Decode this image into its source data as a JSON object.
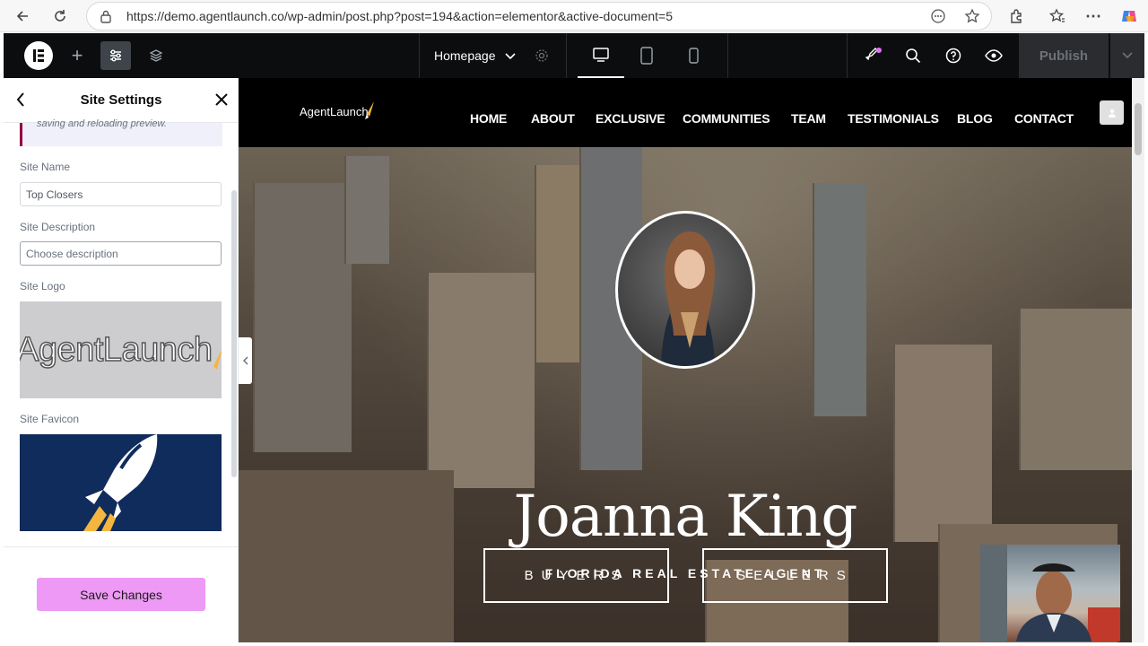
{
  "browser": {
    "url": "https://demo.agentlaunch.co/wp-admin/post.php?post=194&action=elementor&active-document=5"
  },
  "editor": {
    "page_selector": "Homepage",
    "publish_label": "Publish"
  },
  "panel": {
    "title": "Site Settings",
    "notice_text": "saving and reloading preview.",
    "site_name_label": "Site Name",
    "site_name_value": "Top Closers",
    "site_description_label": "Site Description",
    "site_description_placeholder": "Choose description",
    "site_logo_label": "Site Logo",
    "logo_text": "AgentLaunch",
    "site_favicon_label": "Site Favicon",
    "save_label": "Save Changes"
  },
  "site": {
    "logo_text": "AgentLaunch",
    "nav": [
      "HOME",
      "ABOUT",
      "EXCLUSIVE",
      "COMMUNITIES",
      "TEAM",
      "TESTIMONIALS",
      "BLOG",
      "CONTACT"
    ],
    "hero_name": "Joanna King",
    "hero_subtitle": "FLORIDA REAL ESTATE AGENT",
    "buttons": [
      "BUYERS",
      "SELLERS"
    ]
  },
  "colors": {
    "save_button": "#ee99f5",
    "editor_bar": "#0c0d0e",
    "favicon_bg": "#0f2c5c"
  }
}
